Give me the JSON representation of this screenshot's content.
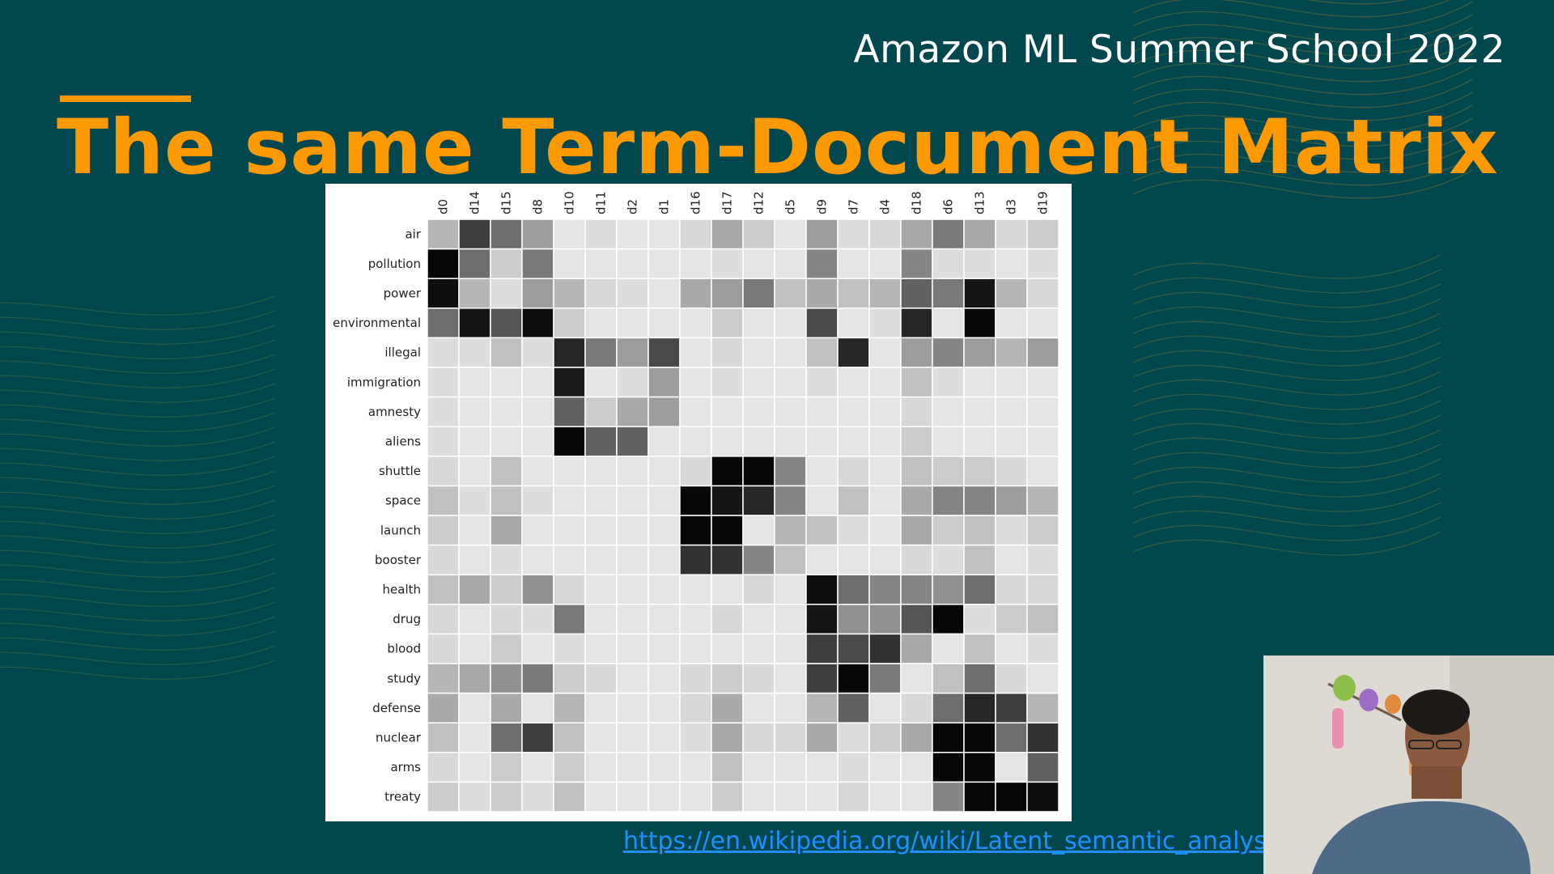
{
  "slide": {
    "brand": "Amazon ML Summer School 2022",
    "title": "The same Term-Document Matrix",
    "source_link": "https://en.wikipedia.org/wiki/Latent_semantic_analysis"
  },
  "colors": {
    "background": "#02474d",
    "accent": "#ff9900",
    "title": "#ff9900",
    "link": "#1f8fff"
  },
  "chart_data": {
    "type": "heatmap",
    "title": "",
    "xlabel": "",
    "ylabel": "",
    "x": [
      "d0",
      "d14",
      "d15",
      "d8",
      "d10",
      "d11",
      "d2",
      "d1",
      "d16",
      "d17",
      "d12",
      "d5",
      "d9",
      "d7",
      "d4",
      "d18",
      "d6",
      "d13",
      "d3",
      "d19"
    ],
    "y": [
      "air",
      "pollution",
      "power",
      "environmental",
      "illegal",
      "immigration",
      "amnesty",
      "aliens",
      "shuttle",
      "space",
      "launch",
      "booster",
      "health",
      "drug",
      "blood",
      "study",
      "defense",
      "nuclear",
      "arms",
      "treaty"
    ],
    "scale": "grayscale, darker = higher value, 0 to 1",
    "values": [
      [
        0.25,
        0.75,
        0.55,
        0.35,
        0.05,
        0.08,
        0.05,
        0.05,
        0.1,
        0.3,
        0.15,
        0.05,
        0.35,
        0.08,
        0.1,
        0.3,
        0.5,
        0.3,
        0.1,
        0.15
      ],
      [
        0.98,
        0.55,
        0.15,
        0.5,
        0.05,
        0.05,
        0.05,
        0.05,
        0.05,
        0.08,
        0.05,
        0.05,
        0.45,
        0.05,
        0.05,
        0.45,
        0.08,
        0.08,
        0.05,
        0.08
      ],
      [
        0.95,
        0.25,
        0.08,
        0.35,
        0.25,
        0.1,
        0.08,
        0.05,
        0.3,
        0.35,
        0.5,
        0.2,
        0.3,
        0.2,
        0.25,
        0.6,
        0.5,
        0.92,
        0.25,
        0.1
      ],
      [
        0.55,
        0.92,
        0.65,
        0.95,
        0.15,
        0.05,
        0.05,
        0.05,
        0.05,
        0.15,
        0.05,
        0.05,
        0.7,
        0.05,
        0.08,
        0.85,
        0.05,
        0.98,
        0.05,
        0.05
      ],
      [
        0.08,
        0.08,
        0.2,
        0.08,
        0.85,
        0.5,
        0.35,
        0.7,
        0.05,
        0.1,
        0.05,
        0.05,
        0.2,
        0.85,
        0.05,
        0.35,
        0.45,
        0.35,
        0.25,
        0.35
      ],
      [
        0.08,
        0.05,
        0.05,
        0.05,
        0.9,
        0.05,
        0.08,
        0.35,
        0.05,
        0.08,
        0.05,
        0.05,
        0.08,
        0.05,
        0.05,
        0.2,
        0.08,
        0.05,
        0.05,
        0.05
      ],
      [
        0.08,
        0.05,
        0.05,
        0.05,
        0.6,
        0.15,
        0.3,
        0.35,
        0.05,
        0.05,
        0.05,
        0.05,
        0.05,
        0.05,
        0.05,
        0.1,
        0.05,
        0.05,
        0.05,
        0.05
      ],
      [
        0.08,
        0.05,
        0.05,
        0.05,
        0.98,
        0.6,
        0.6,
        0.05,
        0.05,
        0.05,
        0.05,
        0.05,
        0.05,
        0.05,
        0.05,
        0.15,
        0.05,
        0.05,
        0.05,
        0.05
      ],
      [
        0.1,
        0.05,
        0.2,
        0.05,
        0.05,
        0.05,
        0.05,
        0.05,
        0.1,
        0.98,
        0.98,
        0.45,
        0.05,
        0.1,
        0.05,
        0.2,
        0.15,
        0.15,
        0.1,
        0.05
      ],
      [
        0.2,
        0.08,
        0.2,
        0.08,
        0.05,
        0.05,
        0.05,
        0.05,
        0.98,
        0.92,
        0.85,
        0.45,
        0.05,
        0.2,
        0.05,
        0.3,
        0.45,
        0.45,
        0.35,
        0.25
      ],
      [
        0.15,
        0.05,
        0.3,
        0.05,
        0.05,
        0.05,
        0.05,
        0.05,
        0.98,
        0.98,
        0.05,
        0.25,
        0.2,
        0.08,
        0.05,
        0.3,
        0.15,
        0.2,
        0.08,
        0.15
      ],
      [
        0.1,
        0.05,
        0.08,
        0.05,
        0.05,
        0.05,
        0.05,
        0.05,
        0.8,
        0.8,
        0.45,
        0.2,
        0.05,
        0.05,
        0.05,
        0.1,
        0.08,
        0.2,
        0.05,
        0.08
      ],
      [
        0.2,
        0.3,
        0.15,
        0.4,
        0.1,
        0.05,
        0.05,
        0.05,
        0.05,
        0.05,
        0.1,
        0.05,
        0.95,
        0.55,
        0.45,
        0.45,
        0.4,
        0.55,
        0.1,
        0.1
      ],
      [
        0.1,
        0.05,
        0.1,
        0.08,
        0.5,
        0.05,
        0.05,
        0.05,
        0.05,
        0.1,
        0.05,
        0.05,
        0.92,
        0.4,
        0.4,
        0.65,
        0.98,
        0.08,
        0.15,
        0.2
      ],
      [
        0.1,
        0.05,
        0.15,
        0.05,
        0.08,
        0.05,
        0.05,
        0.05,
        0.05,
        0.05,
        0.05,
        0.05,
        0.75,
        0.7,
        0.8,
        0.3,
        0.05,
        0.2,
        0.05,
        0.08
      ],
      [
        0.25,
        0.3,
        0.4,
        0.5,
        0.15,
        0.1,
        0.05,
        0.05,
        0.1,
        0.15,
        0.1,
        0.05,
        0.75,
        0.98,
        0.5,
        0.05,
        0.2,
        0.55,
        0.1,
        0.05
      ],
      [
        0.3,
        0.05,
        0.3,
        0.05,
        0.25,
        0.05,
        0.05,
        0.05,
        0.1,
        0.3,
        0.05,
        0.05,
        0.25,
        0.6,
        0.05,
        0.1,
        0.55,
        0.85,
        0.75,
        0.25
      ],
      [
        0.2,
        0.05,
        0.55,
        0.75,
        0.2,
        0.05,
        0.05,
        0.05,
        0.08,
        0.3,
        0.1,
        0.1,
        0.3,
        0.08,
        0.15,
        0.3,
        0.98,
        0.98,
        0.55,
        0.8
      ],
      [
        0.1,
        0.05,
        0.15,
        0.05,
        0.15,
        0.05,
        0.05,
        0.05,
        0.05,
        0.2,
        0.05,
        0.05,
        0.05,
        0.08,
        0.05,
        0.05,
        0.98,
        0.98,
        0.05,
        0.6
      ],
      [
        0.15,
        0.08,
        0.15,
        0.08,
        0.2,
        0.05,
        0.05,
        0.05,
        0.05,
        0.15,
        0.05,
        0.05,
        0.05,
        0.1,
        0.05,
        0.05,
        0.45,
        0.98,
        0.98,
        0.95
      ]
    ]
  },
  "webcam": {
    "visible": true
  }
}
